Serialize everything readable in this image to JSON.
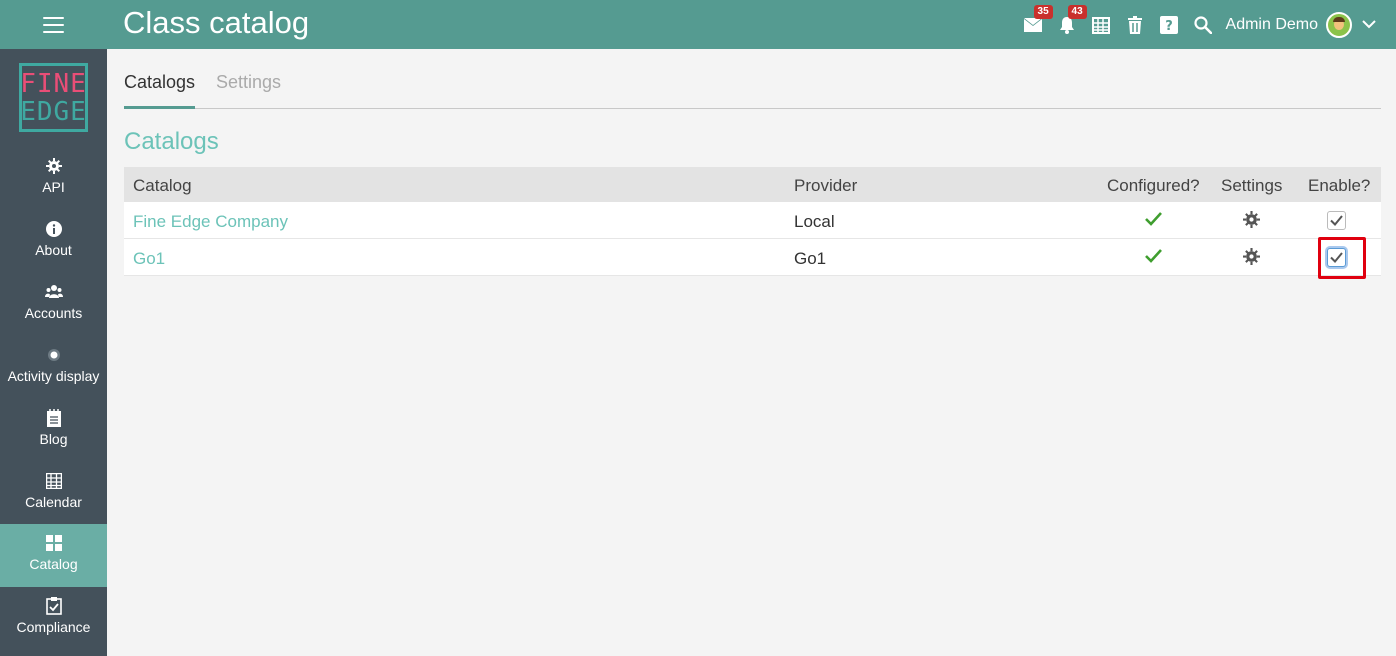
{
  "header": {
    "title": "Class catalog",
    "mail_badge": "35",
    "notifications_badge": "43",
    "user_name": "Admin Demo",
    "menu_icon": "hamburger-icon",
    "icons": [
      "mail-icon",
      "bell-icon",
      "calendar-icon",
      "trash-icon",
      "help-icon",
      "search-icon"
    ]
  },
  "logo": {
    "line1": "FINE",
    "line2": "EDGE"
  },
  "sidebar": {
    "items": [
      {
        "label": "API",
        "icon": "gear-icon"
      },
      {
        "label": "About",
        "icon": "info-icon"
      },
      {
        "label": "Accounts",
        "icon": "users-icon"
      },
      {
        "label": "Activity display",
        "icon": "dot-icon"
      },
      {
        "label": "Blog",
        "icon": "notebook-icon"
      },
      {
        "label": "Calendar",
        "icon": "calendar-icon"
      },
      {
        "label": "Catalog",
        "icon": "grid-icon",
        "active": true
      },
      {
        "label": "Compliance",
        "icon": "clipboard-check-icon"
      }
    ]
  },
  "tabs": [
    {
      "label": "Catalogs",
      "active": true
    },
    {
      "label": "Settings",
      "active": false
    }
  ],
  "section_title": "Catalogs",
  "table": {
    "headers": {
      "catalog": "Catalog",
      "provider": "Provider",
      "configured": "Configured?",
      "settings": "Settings",
      "enable": "Enable?"
    },
    "rows": [
      {
        "catalog": "Fine Edge Company",
        "provider": "Local",
        "configured": true,
        "enabled": true
      },
      {
        "catalog": "Go1",
        "provider": "Go1",
        "configured": true,
        "enabled": true
      }
    ]
  },
  "colors": {
    "topbar": "#559b91",
    "sidebar": "#44515b",
    "sidebar_active": "#6aaea5",
    "accent_text": "#6cc3b8",
    "badge": "#c9302c",
    "check": "#3f9e2f",
    "highlight": "#e0000f"
  }
}
